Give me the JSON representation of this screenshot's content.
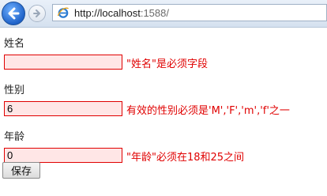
{
  "browser": {
    "url_host": "http://localhost",
    "url_rest": ":1588/",
    "icons": {
      "back": "back-arrow-icon",
      "forward": "forward-arrow-icon",
      "page": "ie-page-icon"
    }
  },
  "form": {
    "name": {
      "label": "姓名",
      "value": "",
      "error": "\"姓名\"是必须字段"
    },
    "gender": {
      "label": "性别",
      "value": "6",
      "error": "有效的性别必须是'M','F','m','f'之一"
    },
    "age": {
      "label": "年龄",
      "value": "0",
      "error": "\"年龄\"必须在18和25之间"
    },
    "submit_label": "保存"
  },
  "colors": {
    "error": "#e00000",
    "error_bg": "#ffe6e6",
    "accent": "#1f63c9"
  }
}
